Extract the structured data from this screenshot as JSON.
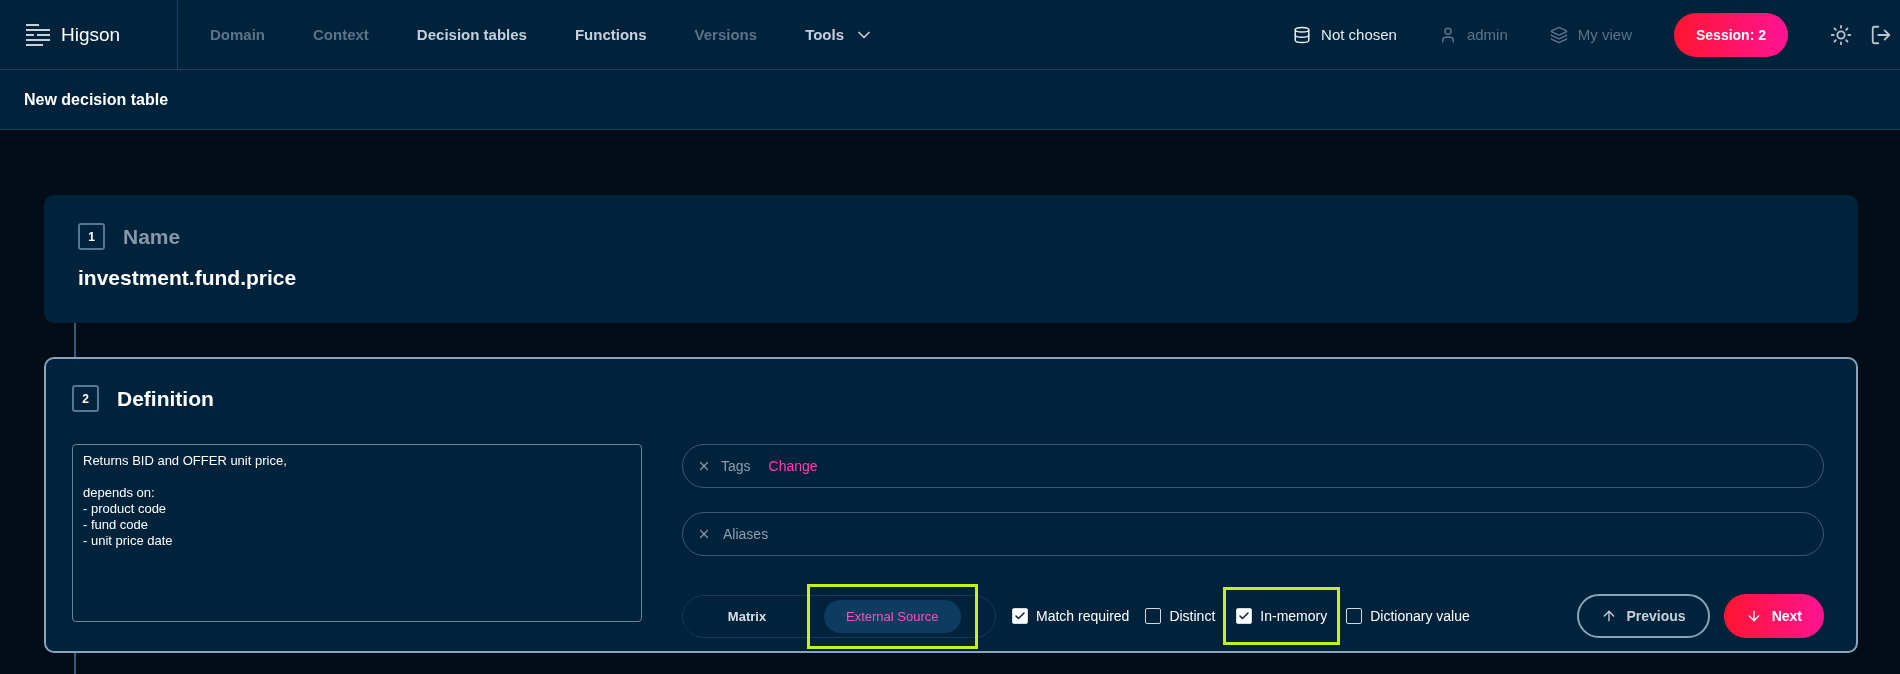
{
  "app": {
    "logo": "Higson"
  },
  "nav": [
    {
      "label": "Domain",
      "disabled": true,
      "kind": "link"
    },
    {
      "label": "Context",
      "disabled": true,
      "kind": "link"
    },
    {
      "label": "Decision tables",
      "disabled": false,
      "kind": "link"
    },
    {
      "label": "Functions",
      "disabled": false,
      "kind": "link"
    },
    {
      "label": "Versions",
      "disabled": true,
      "kind": "link"
    },
    {
      "label": "Tools",
      "disabled": false,
      "kind": "menu"
    }
  ],
  "status_items": [
    {
      "kind": "database",
      "label": "Not chosen",
      "disabled": false
    },
    {
      "kind": "user",
      "label": "admin",
      "disabled": true
    },
    {
      "kind": "layers",
      "label": "My view",
      "disabled": true
    }
  ],
  "session": "Session: 2",
  "page_title": "New decision table",
  "steps": [
    {
      "number": "1",
      "title": "Name",
      "active": false,
      "value": "investment.fund.price"
    },
    {
      "number": "2",
      "title": "Definition",
      "active": true
    }
  ],
  "definition": {
    "description": "Returns BID and OFFER unit price,\n\ndepends on:\n- product code\n- fund code\n- unit price date",
    "tags": {
      "label": "Tags",
      "action": "Change"
    },
    "aliases": {
      "placeholder": "Aliases"
    },
    "modes": [
      {
        "label": "Matrix",
        "selected": false,
        "highlighted": false
      },
      {
        "label": "External Source",
        "selected": true,
        "highlighted": true
      }
    ],
    "options": [
      {
        "label": "Match required",
        "checked": true,
        "highlighted": false
      },
      {
        "label": "Distinct",
        "checked": false,
        "highlighted": false
      },
      {
        "label": "In-memory",
        "checked": true,
        "highlighted": true
      },
      {
        "label": "Dictionary value",
        "checked": false,
        "highlighted": false
      }
    ],
    "buttons": [
      {
        "label": "Previous",
        "kind": "secondary"
      },
      {
        "label": "Next",
        "kind": "primary"
      }
    ]
  }
}
